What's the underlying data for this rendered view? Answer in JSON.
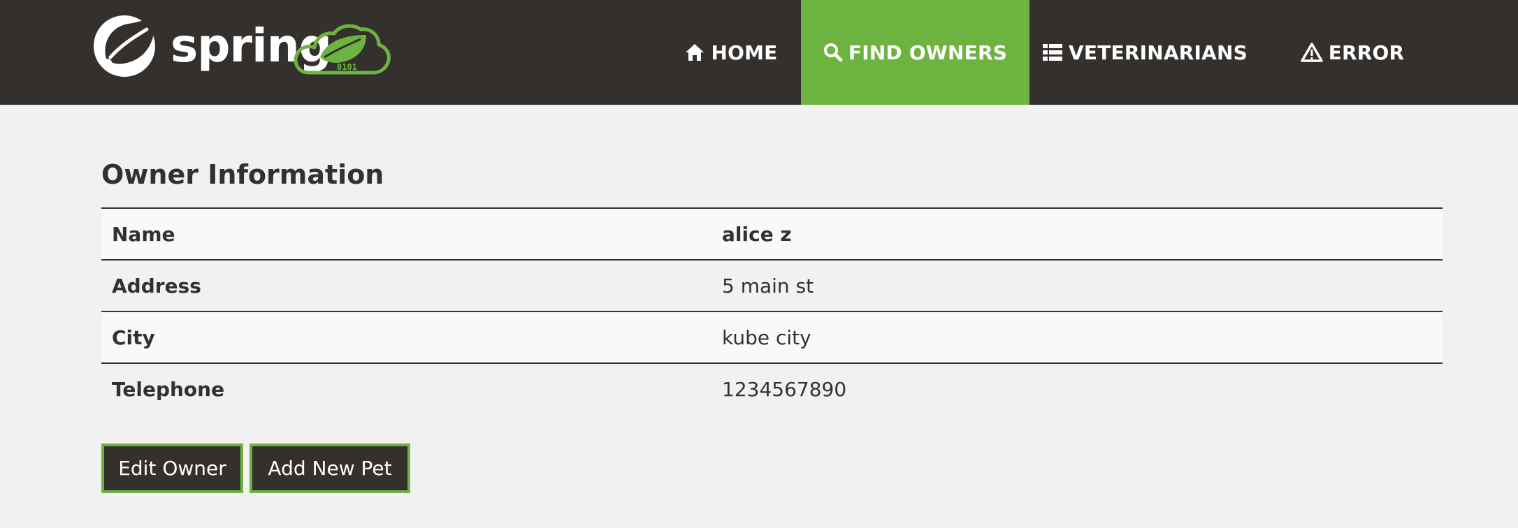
{
  "brand": {
    "name": "spring",
    "badge_text": "0101"
  },
  "nav": {
    "items": [
      {
        "label": "HOME",
        "icon": "home-icon"
      },
      {
        "label": "FIND OWNERS",
        "icon": "search-icon",
        "active": true
      },
      {
        "label": "VETERINARIANS",
        "icon": "list-icon"
      },
      {
        "label": "ERROR",
        "icon": "warning-icon"
      }
    ]
  },
  "main": {
    "title": "Owner Information",
    "owner": {
      "rows": [
        {
          "label": "Name",
          "value": "alice z"
        },
        {
          "label": "Address",
          "value": "5 main st"
        },
        {
          "label": "City",
          "value": "kube city"
        },
        {
          "label": "Telephone",
          "value": "1234567890"
        }
      ]
    },
    "buttons": {
      "edit": "Edit Owner",
      "add_pet": "Add New Pet"
    }
  },
  "colors": {
    "brand_green": "#6db33f",
    "dark": "#34302d",
    "background": "#f1f1f1"
  }
}
